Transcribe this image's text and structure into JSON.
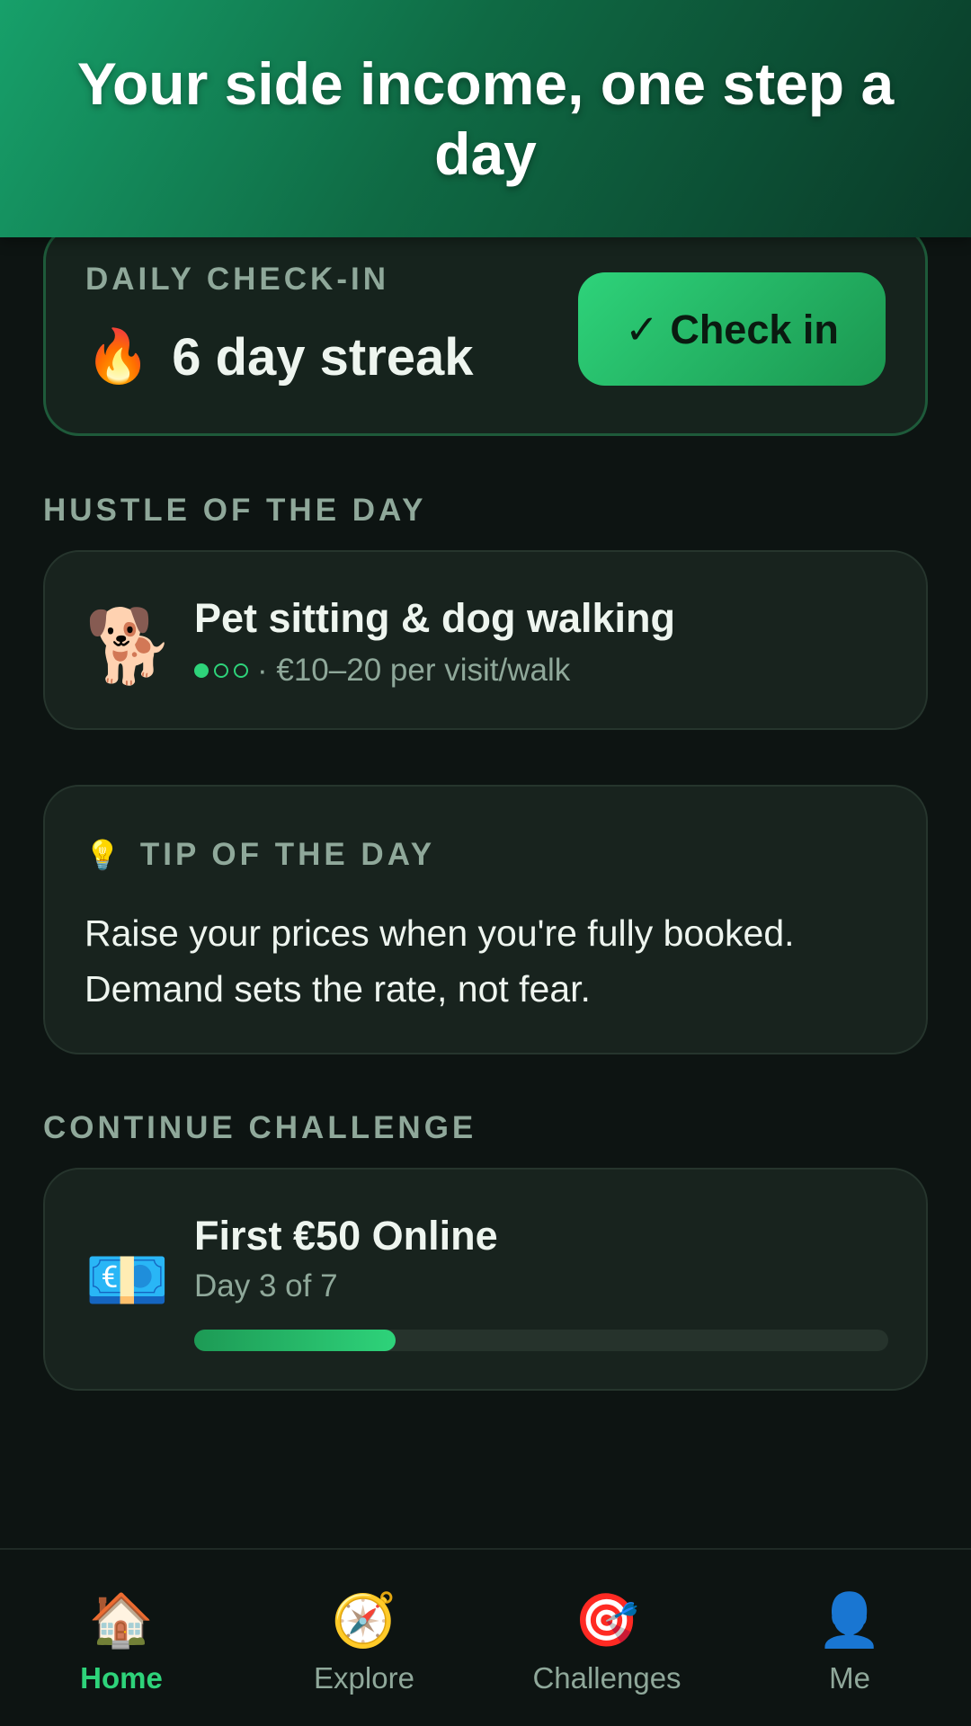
{
  "header": {
    "title": "Your side income, one step a day"
  },
  "checkin": {
    "label": "DAILY CHECK-IN",
    "streak_icon": "🔥",
    "streak_text": "6 day streak",
    "button_label": "✓ Check in"
  },
  "hustle_section": {
    "title": "HUSTLE OF THE DAY"
  },
  "hustle": {
    "icon": "🐕",
    "title": "Pet sitting & dog walking",
    "difficulty": 1,
    "difficulty_max": 3,
    "earnings": "· €10–20 per visit/walk"
  },
  "tip": {
    "icon": "💡",
    "label": "TIP OF THE DAY",
    "text": "Raise your prices when you're fully booked. Demand sets the rate, not fear."
  },
  "challenge_section": {
    "title": "CONTINUE CHALLENGE"
  },
  "challenge": {
    "icon": "💶",
    "title": "First €50 Online",
    "progress_text": "Day 3 of 7",
    "progress_fraction": 0.29
  },
  "tabs": [
    {
      "icon": "🏠",
      "label": "Home",
      "active": true
    },
    {
      "icon": "🧭",
      "label": "Explore",
      "active": false
    },
    {
      "icon": "🎯",
      "label": "Challenges",
      "active": false
    },
    {
      "icon": "👤",
      "label": "Me",
      "active": false
    }
  ],
  "colors": {
    "accent": "#2ed37a",
    "background": "#0d1412",
    "card": "#18231e",
    "muted": "#8fa89a"
  }
}
